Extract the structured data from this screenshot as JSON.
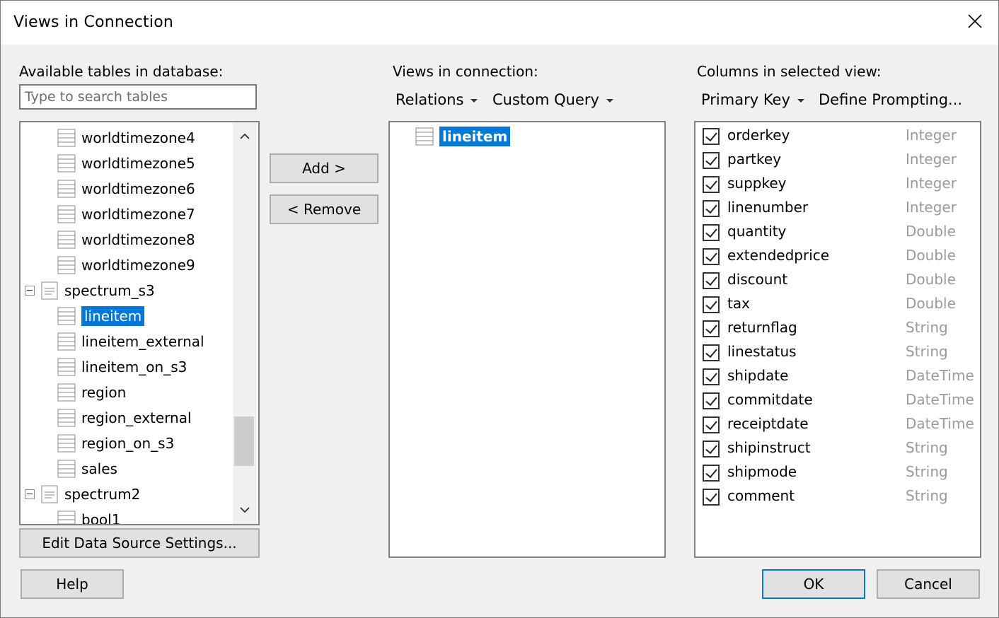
{
  "window": {
    "title": "Views in Connection"
  },
  "left": {
    "label": "Available tables in database:",
    "search_placeholder": "Type to search tables",
    "tree": [
      {
        "label": "worldtimezone4",
        "level": 2,
        "kind": "table"
      },
      {
        "label": "worldtimezone5",
        "level": 2,
        "kind": "table"
      },
      {
        "label": "worldtimezone6",
        "level": 2,
        "kind": "table"
      },
      {
        "label": "worldtimezone7",
        "level": 2,
        "kind": "table"
      },
      {
        "label": "worldtimezone8",
        "level": 2,
        "kind": "table"
      },
      {
        "label": "worldtimezone9",
        "level": 2,
        "kind": "table"
      },
      {
        "label": "spectrum_s3",
        "level": 1,
        "kind": "schema"
      },
      {
        "label": "lineitem",
        "level": 2,
        "kind": "table",
        "selected": true
      },
      {
        "label": "lineitem_external",
        "level": 2,
        "kind": "table"
      },
      {
        "label": "lineitem_on_s3",
        "level": 2,
        "kind": "table"
      },
      {
        "label": "region",
        "level": 2,
        "kind": "table"
      },
      {
        "label": "region_external",
        "level": 2,
        "kind": "table"
      },
      {
        "label": "region_on_s3",
        "level": 2,
        "kind": "table"
      },
      {
        "label": "sales",
        "level": 2,
        "kind": "table"
      },
      {
        "label": "spectrum2",
        "level": 1,
        "kind": "schema"
      },
      {
        "label": "bool1",
        "level": 2,
        "kind": "table"
      }
    ],
    "edit_button": "Edit Data Source Settings..."
  },
  "middle": {
    "add_button": "Add >",
    "remove_button": "< Remove",
    "label": "Views in connection:",
    "relations_menu": "Relations",
    "custom_query_menu": "Custom Query",
    "views": [
      {
        "label": "lineitem",
        "selected": true
      }
    ]
  },
  "right": {
    "label": "Columns in selected view:",
    "primary_key_menu": "Primary Key",
    "define_prompting": "Define Prompting...",
    "columns": [
      {
        "name": "orderkey",
        "type": "Integer",
        "checked": true
      },
      {
        "name": "partkey",
        "type": "Integer",
        "checked": true
      },
      {
        "name": "suppkey",
        "type": "Integer",
        "checked": true
      },
      {
        "name": "linenumber",
        "type": "Integer",
        "checked": true
      },
      {
        "name": "quantity",
        "type": "Double",
        "checked": true
      },
      {
        "name": "extendedprice",
        "type": "Double",
        "checked": true
      },
      {
        "name": "discount",
        "type": "Double",
        "checked": true
      },
      {
        "name": "tax",
        "type": "Double",
        "checked": true
      },
      {
        "name": "returnflag",
        "type": "String",
        "checked": true
      },
      {
        "name": "linestatus",
        "type": "String",
        "checked": true
      },
      {
        "name": "shipdate",
        "type": "DateTime",
        "checked": true
      },
      {
        "name": "commitdate",
        "type": "DateTime",
        "checked": true
      },
      {
        "name": "receiptdate",
        "type": "DateTime",
        "checked": true
      },
      {
        "name": "shipinstruct",
        "type": "String",
        "checked": true
      },
      {
        "name": "shipmode",
        "type": "String",
        "checked": true
      },
      {
        "name": "comment",
        "type": "String",
        "checked": true
      }
    ]
  },
  "footer": {
    "help": "Help",
    "ok": "OK",
    "cancel": "Cancel"
  },
  "icons": {
    "close": "close-icon",
    "table": "table-icon",
    "schema": "schema-icon",
    "expand": "collapse-toggle-icon",
    "scroll_up": "scroll-up-icon",
    "scroll_down": "scroll-down-icon",
    "dropdown": "chevron-down-icon",
    "checkbox": "checkbox-icon"
  },
  "colors": {
    "selection": "#0078d7",
    "type_text": "#9a9a9a",
    "dialog_bg": "#f0f0f0"
  }
}
